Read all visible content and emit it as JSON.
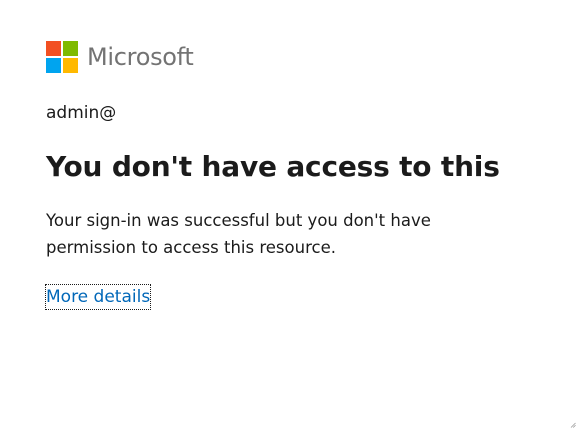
{
  "brand": {
    "name": "Microsoft",
    "logo_colors": [
      "#f25022",
      "#7fba00",
      "#00a4ef",
      "#ffb900"
    ]
  },
  "account": {
    "username": "admin@"
  },
  "heading": "You don't have access to this",
  "message": "Your sign-in was successful but you don't have permission to access this resource.",
  "more_details_link": "More details",
  "colors": {
    "link": "#0067b8",
    "text": "#1b1b1b",
    "brand_text": "#737373"
  }
}
